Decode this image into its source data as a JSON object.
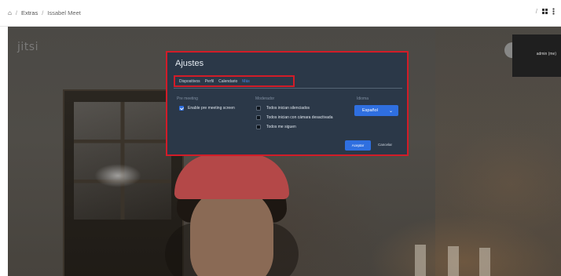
{
  "breadcrumb": {
    "home_icon": "home-icon",
    "sep1": "/",
    "extras": "Extras",
    "sep2": "/",
    "current": "Issabel Meet"
  },
  "topright": {
    "slash": "/",
    "icons": [
      "grid-icon",
      "more-icon"
    ]
  },
  "meeting": {
    "logo": "jitsi",
    "participant_label": "admin (me)"
  },
  "settings": {
    "title": "Ajustes",
    "tabs": [
      "Dispositivos",
      "Perfil",
      "Calendario",
      "Más"
    ],
    "active_tab": "Más",
    "pre_meeting_label": "Pre meeting",
    "pre_meeting_option": "Enable pre meeting screen",
    "pre_meeting_checked": true,
    "moderator_label": "Moderador",
    "moderator_options": [
      "Todos inician silenciados",
      "Todos inician con cámara desactivada",
      "Todos me siguen"
    ],
    "language_label": "Idioma",
    "language_value": "Español",
    "accept_button": "Aceptar",
    "cancel_button": "Cancelar"
  },
  "colors": {
    "dialog_bg": "#2b3848",
    "accent": "#2f6fe0",
    "highlight_border": "#d21c28"
  }
}
